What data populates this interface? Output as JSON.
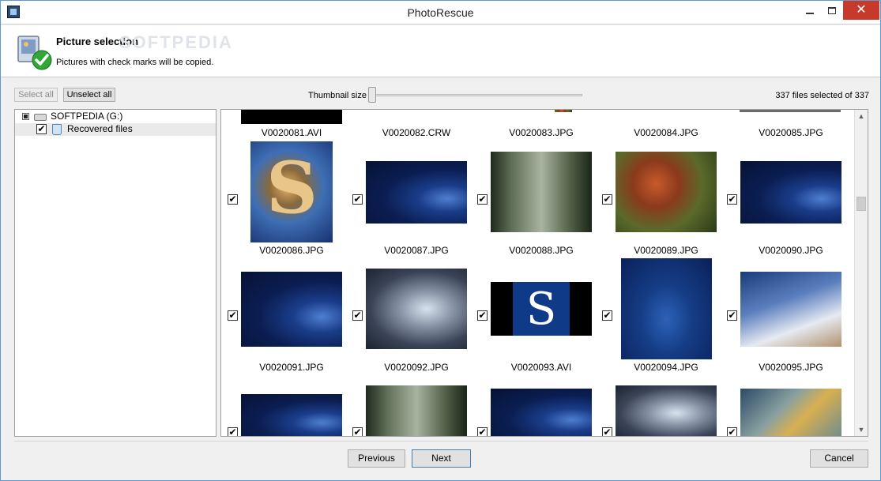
{
  "window": {
    "title": "PhotoRescue",
    "close_glyph": "✕"
  },
  "header": {
    "title": "Picture selection",
    "subtitle": "Pictures with check marks will be copied.",
    "icon": "picture-check-icon",
    "watermark": "SOFTPEDIA"
  },
  "toolbar": {
    "select_all": "Select all",
    "unselect_all": "Unselect all",
    "thumbnail_label": "Thumbnail size",
    "thumbnail_level": 0,
    "count_text": "337 files selected of 337"
  },
  "tree": {
    "root_label": "SOFTPEDIA (G:)",
    "child_label": "Recovered files",
    "child_checked": true
  },
  "grid": {
    "top_row": [
      "V0020081.AVI",
      "V0020082.CRW",
      "V0020083.JPG",
      "V0020084.JPG",
      "V0020085.JPG"
    ],
    "rows": [
      [
        "V0020086.JPG",
        "V0020087.JPG",
        "V0020088.JPG",
        "V0020089.JPG",
        "V0020090.JPG"
      ],
      [
        "V0020091.JPG",
        "V0020092.JPG",
        "V0020093.AVI",
        "V0020094.JPG",
        "V0020095.JPG"
      ]
    ],
    "check_glyph": "✔"
  },
  "footer": {
    "previous": "Previous",
    "next": "Next",
    "cancel": "Cancel"
  },
  "colors": {
    "close_red": "#c7392b",
    "accent": "#3c7fb1",
    "check_green": "#2fa836"
  }
}
